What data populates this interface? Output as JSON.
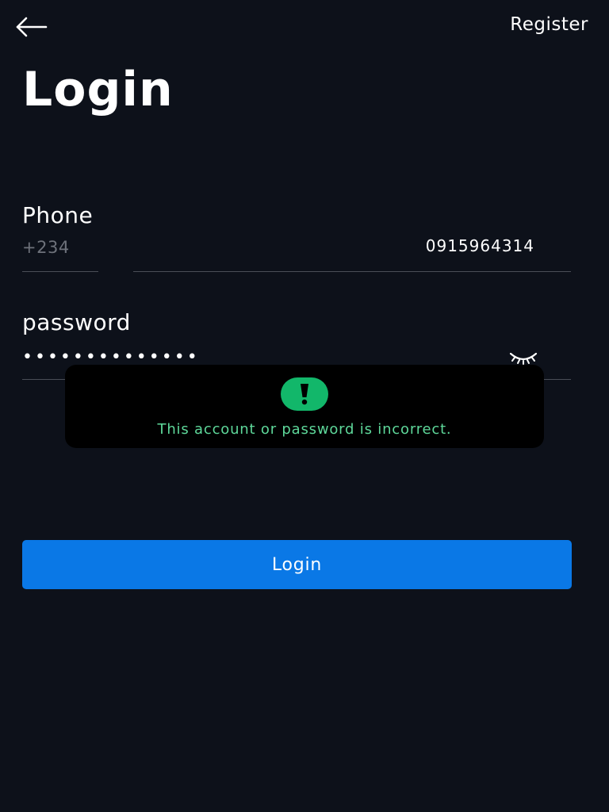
{
  "header": {
    "back_icon": "arrow-left-icon",
    "register_label": "Register"
  },
  "title": "Login",
  "phone": {
    "label": "Phone",
    "country_code": "+234",
    "value": "0915964314"
  },
  "password": {
    "label": "password",
    "masked_value": "••••••••••••••",
    "visibility_icon": "eye-closed-icon"
  },
  "toast": {
    "icon": "exclamation-icon",
    "message": "This account or password is incorrect.",
    "icon_color": "#12b76a",
    "text_color": "#5ed89a"
  },
  "login_button": {
    "label": "Login",
    "color": "#0a78e6"
  },
  "colors": {
    "background": "#0d111a",
    "text": "#ffffff",
    "muted": "#6e727b",
    "divider": "#4a4e57"
  }
}
